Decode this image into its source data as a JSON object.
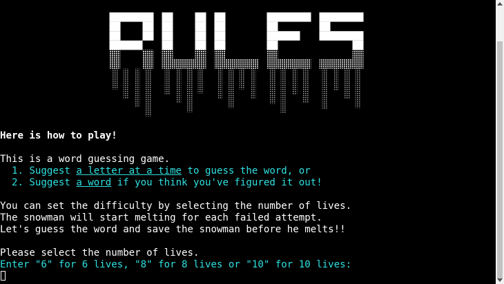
{
  "banner": {
    "title": "RULES",
    "fill_color": "#ffffff",
    "shade_color": "#bdbdbd"
  },
  "terminal": {
    "heading": "Here is how to play!",
    "intro": "This is a word guessing game.",
    "rule1": {
      "prefix": "  1. Suggest ",
      "link": "a letter at a time",
      "suffix": " to guess the word, or"
    },
    "rule2": {
      "prefix": "  2. Suggest ",
      "link": "a word",
      "suffix": " if you think you've figured it out!"
    },
    "para1": "You can set the difficulty by selecting the number of lives.",
    "para2": "The snowman will start melting for each failed attempt.",
    "para3": "Let's guess the word and save the snowman before he melts!!",
    "select_prompt": "Please select the number of lives.",
    "enter_prompt": "Enter \"6\" for 6 lives, \"8\" for 8 lives or \"10\" for 10 lives: ",
    "accent_color": "#2fe0e0"
  }
}
